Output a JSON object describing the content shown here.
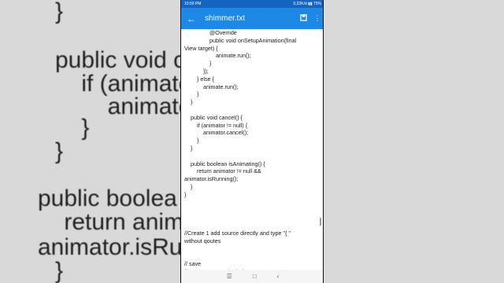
{
  "status": {
    "time": "10:50 PM",
    "network": "0,22K/d",
    "battery": "75%"
  },
  "appbar": {
    "title": "shimmer.txt"
  },
  "icons": {
    "back": "arrow-back-icon",
    "save": "save-icon",
    "menu": "overflow-menu-icon"
  },
  "bg_left": [
    "}",
    "",
    "public void c",
    "    if (animato",
    "        animato",
    "    }",
    "}",
    "",
    "public boolea",
    "    return anim",
    "animator.isRu",
    "}"
  ],
  "code": [
    "                @Override",
    "                public void onSetupAnimation(final",
    "View target) {",
    "                    animate.run();",
    "                }",
    "            });",
    "        } else {",
    "            animate.run();",
    "        }",
    "    }",
    "",
    "    public void cancel() {",
    "        if (animator != null) {",
    "            animator.cancel();",
    "        }",
    "    }",
    "",
    "    public boolean isAnimating() {",
    "        return animator != null &&",
    "animator.isRunning();",
    "    }",
    "}",
    "",
    "",
    "",
    "",
    "//Create 1 add source directly and type \"{ \"",
    "without qoutes",
    "",
    "",
    "// save",
    "// Go to generate logic / event"
  ]
}
